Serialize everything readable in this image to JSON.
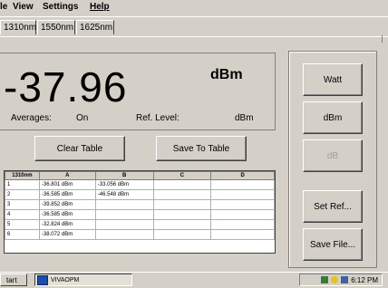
{
  "menu": {
    "items": [
      {
        "label": "le"
      },
      {
        "label": "View"
      },
      {
        "label": "Settings"
      },
      {
        "label": "Help"
      }
    ]
  },
  "tabs": [
    {
      "label": "1310nm"
    },
    {
      "label": "1550nm"
    },
    {
      "label": "1625nm"
    }
  ],
  "readout": {
    "value": "-37.96",
    "unit": "dBm",
    "averages_label": "Averages:",
    "averages_value": "On",
    "ref_level_label": "Ref. Level:",
    "ref_level_value": "dBm"
  },
  "buttons": {
    "clear_table": "Clear Table",
    "save_to_table": "Save To Table",
    "watt": "Watt",
    "dbm": "dBm",
    "db": "dB",
    "set_ref": "Set Ref...",
    "save_file": "Save File..."
  },
  "table": {
    "corner": "1310nm",
    "columns": [
      "A",
      "B",
      "C",
      "D"
    ],
    "rows": [
      {
        "num": "1",
        "a": "-36.801 dBm",
        "b": "-33.056 dBm",
        "c": "",
        "d": ""
      },
      {
        "num": "2",
        "a": "-36.585 dBm",
        "b": "-46.548 dBm",
        "c": "",
        "d": ""
      },
      {
        "num": "3",
        "a": "-39.852 dBm",
        "b": "",
        "c": "",
        "d": ""
      },
      {
        "num": "4",
        "a": "-36.585 dBm",
        "b": "",
        "c": "",
        "d": ""
      },
      {
        "num": "5",
        "a": "-32.824 dBm",
        "b": "",
        "c": "",
        "d": ""
      },
      {
        "num": "6",
        "a": "-38.072 dBm",
        "b": "",
        "c": "",
        "d": ""
      }
    ]
  },
  "taskbar": {
    "start_label": "tart",
    "task_label": "VIVAOPM",
    "clock": "6:12 PM"
  },
  "icons": {
    "app_icon": "app-window-icon",
    "tray": [
      "network-icon",
      "lightbulb-icon",
      "monitor-icon"
    ]
  }
}
